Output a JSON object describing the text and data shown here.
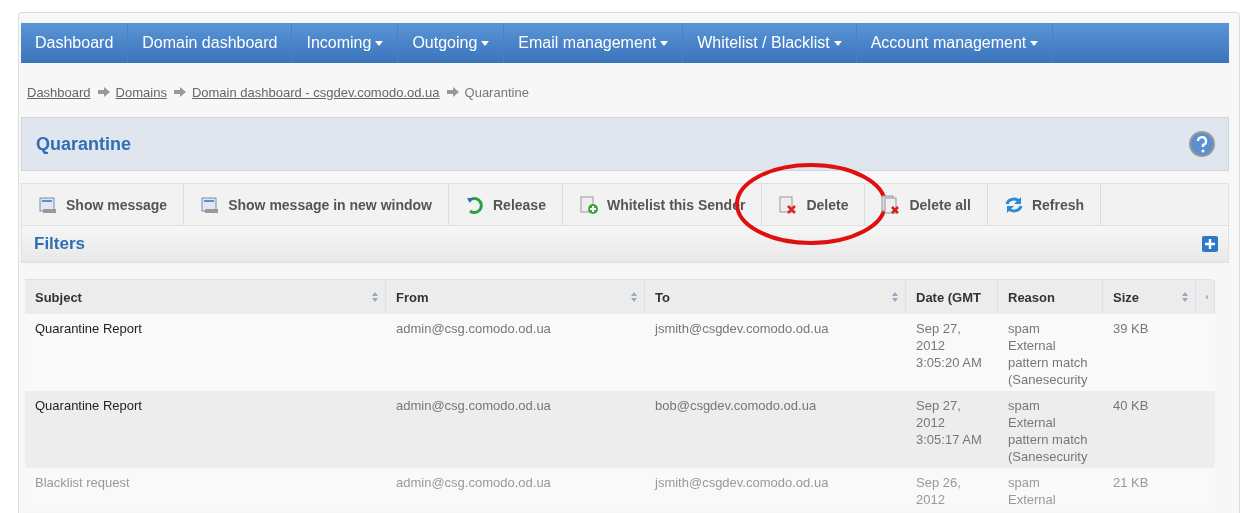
{
  "nav": [
    {
      "label": "Dashboard",
      "dropdown": false
    },
    {
      "label": "Domain dashboard",
      "dropdown": false
    },
    {
      "label": "Incoming",
      "dropdown": true
    },
    {
      "label": "Outgoing",
      "dropdown": true
    },
    {
      "label": "Email management",
      "dropdown": true
    },
    {
      "label": "Whitelist / Blacklist",
      "dropdown": true
    },
    {
      "label": "Account management",
      "dropdown": true
    }
  ],
  "breadcrumb": [
    {
      "label": "Dashboard",
      "link": true
    },
    {
      "label": "Domains",
      "link": true
    },
    {
      "label": "Domain dashboard - csgdev.comodo.od.ua",
      "link": true
    },
    {
      "label": "Quarantine",
      "link": false
    }
  ],
  "panel": {
    "title": "Quarantine"
  },
  "toolbar": [
    {
      "kind": "message",
      "label": "Show message",
      "circled": false
    },
    {
      "kind": "message",
      "label": "Show message in new window",
      "circled": false
    },
    {
      "kind": "release",
      "label": "Release",
      "circled": false
    },
    {
      "kind": "whitelist",
      "label": "Whitelist this Sender",
      "circled": false
    },
    {
      "kind": "delete",
      "label": "Delete",
      "circled": true
    },
    {
      "kind": "delete-all",
      "label": "Delete all",
      "circled": false
    },
    {
      "kind": "refresh",
      "label": "Refresh",
      "circled": false
    }
  ],
  "filters": {
    "title": "Filters"
  },
  "table": {
    "columns": [
      {
        "label": "Subject",
        "sortable": true
      },
      {
        "label": "From",
        "sortable": true
      },
      {
        "label": "To",
        "sortable": true
      },
      {
        "label": "Date (GMT",
        "sortable": false
      },
      {
        "label": "Reason",
        "sortable": false
      },
      {
        "label": "Size",
        "sortable": true
      },
      {
        "kind": "attachment"
      }
    ],
    "rows": [
      {
        "dimmed": false,
        "subject": "Quarantine Report",
        "from": "admin@csg.comodo.od.ua",
        "to": "jsmith@csgdev.comodo.od.ua",
        "date": [
          "Sep 27,",
          "2012",
          "3:05:20 AM"
        ],
        "reason": [
          "spam",
          "External",
          "pattern match",
          "(Sanesecurity"
        ],
        "size": "39 KB"
      },
      {
        "dimmed": false,
        "subject": "Quarantine Report",
        "from": "admin@csg.comodo.od.ua",
        "to": "bob@csgdev.comodo.od.ua",
        "date": [
          "Sep 27,",
          "2012",
          "3:05:17 AM"
        ],
        "reason": [
          "spam",
          "External",
          "pattern match",
          "(Sanesecurity"
        ],
        "size": "40 KB"
      },
      {
        "dimmed": true,
        "subject": "Blacklist request",
        "from": "admin@csg.comodo.od.ua",
        "to": "jsmith@csgdev.comodo.od.ua",
        "date": [
          "Sep 26,",
          "2012"
        ],
        "reason": [
          "spam",
          "External"
        ],
        "size": "21 KB"
      }
    ]
  }
}
